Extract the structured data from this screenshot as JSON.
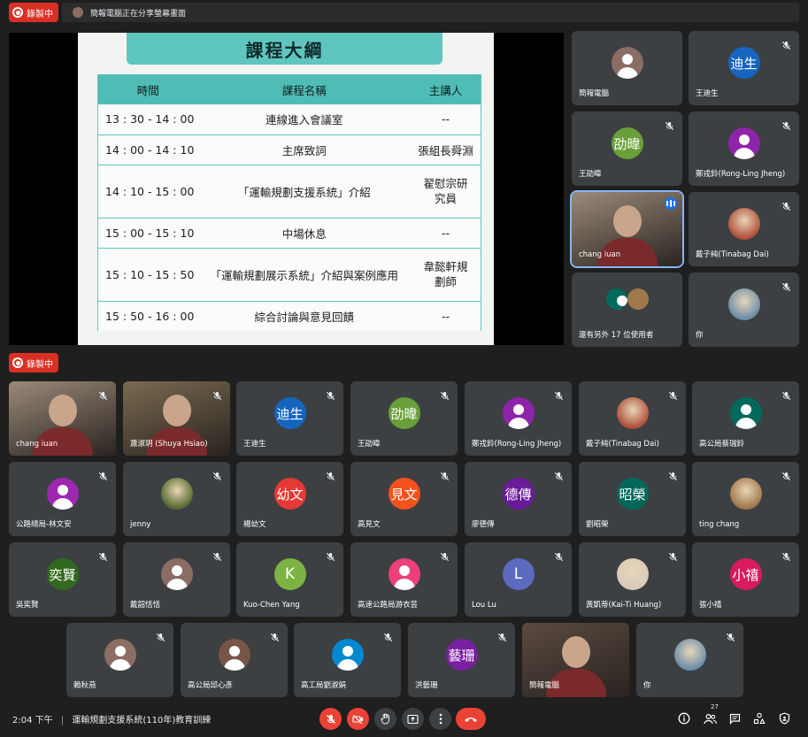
{
  "recording": {
    "label": "錄製中"
  },
  "share_banner": {
    "text": "簡報電腦正在分享螢幕畫面"
  },
  "slide": {
    "title": "課程大綱",
    "headers": [
      "時間",
      "課程名稱",
      "主講人"
    ],
    "rows": [
      {
        "time": "13 : 30 - 14 : 00",
        "course": "連線進入會議室",
        "speaker": "--"
      },
      {
        "time": "14 : 00 - 14 : 10",
        "course": "主席致詞",
        "speaker": "張組長舜淵"
      },
      {
        "time": "14 : 10 - 15 : 00",
        "course": "「運輸規劃支援系統」介紹",
        "speaker": "翟慰宗研究員"
      },
      {
        "time": "15 : 00 - 15 : 10",
        "course": "中場休息",
        "speaker": "--"
      },
      {
        "time": "15 : 10 - 15 : 50",
        "course": "「運輸規劃展示系統」介紹與案例應用",
        "speaker": "韋懿軒規劃師"
      },
      {
        "time": "15 : 50 - 16 : 00",
        "course": "綜合討論與意見回饋",
        "speaker": "--"
      }
    ]
  },
  "right_tiles": [
    {
      "name": "簡報電腦",
      "avatar_text": "",
      "color": "#8a6d63",
      "kind": "person",
      "muted": false
    },
    {
      "name": "王迪生",
      "avatar_text": "迪生",
      "color": "#1565c0",
      "kind": "initials",
      "muted": true
    },
    {
      "name": "王劭暐",
      "avatar_text": "劭暐",
      "color": "#689f38",
      "kind": "initials",
      "muted": true
    },
    {
      "name": "鄭戎鈴(Rong-Ling Jheng)",
      "avatar_text": "",
      "color": "#8e24aa",
      "kind": "person",
      "muted": true
    },
    {
      "name": "chang iuan",
      "avatar_text": "",
      "color": "#9a8a7a",
      "kind": "camera",
      "muted": false
    },
    {
      "name": "戴子純(Tinabag Dai)",
      "avatar_text": "",
      "color": "#b0503a",
      "kind": "image",
      "muted": true
    },
    {
      "name": "還有另外 17 位使用者",
      "avatar_text": "",
      "color": "#00695c",
      "kind": "group",
      "muted": false
    },
    {
      "name": "你",
      "avatar_text": "",
      "color": "#6d8ea8",
      "kind": "image",
      "muted": true
    }
  ],
  "grid_tiles": [
    {
      "name": "chang iuan",
      "avatar_text": "",
      "color": "#9a8a7a",
      "kind": "camera",
      "muted": true
    },
    {
      "name": "蕭淑玥 (Shuya Hsiao)",
      "avatar_text": "",
      "color": "#7a6a50",
      "kind": "camera",
      "muted": true
    },
    {
      "name": "王迪生",
      "avatar_text": "迪生",
      "color": "#1565c0",
      "kind": "initials",
      "muted": true
    },
    {
      "name": "王劭暐",
      "avatar_text": "劭暐",
      "color": "#689f38",
      "kind": "initials",
      "muted": true
    },
    {
      "name": "鄭戎鈴(Rong-Ling Jheng)",
      "avatar_text": "",
      "color": "#8e24aa",
      "kind": "person",
      "muted": true
    },
    {
      "name": "戴子純(Tinabag Dai)",
      "avatar_text": "",
      "color": "#b0503a",
      "kind": "image",
      "muted": true
    },
    {
      "name": "高公局蔡瑞鈴",
      "avatar_text": "",
      "color": "#00695c",
      "kind": "person",
      "muted": true
    },
    {
      "name": "公路總局-林文安",
      "avatar_text": "",
      "color": "#9c27b0",
      "kind": "person",
      "muted": true
    },
    {
      "name": "jenny",
      "avatar_text": "",
      "color": "#556b2f",
      "kind": "image",
      "muted": true
    },
    {
      "name": "楊幼文",
      "avatar_text": "幼文",
      "color": "#e53935",
      "kind": "initials",
      "muted": true
    },
    {
      "name": "高見文",
      "avatar_text": "見文",
      "color": "#f4511e",
      "kind": "initials",
      "muted": true
    },
    {
      "name": "廖德傳",
      "avatar_text": "德傳",
      "color": "#6a1b9a",
      "kind": "initials",
      "muted": true
    },
    {
      "name": "劉昭榮",
      "avatar_text": "昭榮",
      "color": "#00695c",
      "kind": "initials",
      "muted": true
    },
    {
      "name": "ting chang",
      "avatar_text": "",
      "color": "#a0784a",
      "kind": "image",
      "muted": true
    },
    {
      "name": "吳奕賢",
      "avatar_text": "奕賢",
      "color": "#33691e",
      "kind": "initials",
      "muted": true
    },
    {
      "name": "戴韶恬恬",
      "avatar_text": "",
      "color": "#8a6d63",
      "kind": "person",
      "muted": true
    },
    {
      "name": "Kuo-Chen Yang",
      "avatar_text": "K",
      "color": "#7cb342",
      "kind": "initials",
      "muted": true
    },
    {
      "name": "高速公路局游衣芸",
      "avatar_text": "",
      "color": "#ec407a",
      "kind": "person",
      "muted": true
    },
    {
      "name": "Lou Lu",
      "avatar_text": "L",
      "color": "#5c6bc0",
      "kind": "initials",
      "muted": true
    },
    {
      "name": "黃凱蒂(Kai-Ti Huang)",
      "avatar_text": "",
      "color": "#d8cbb8",
      "kind": "image",
      "muted": true
    },
    {
      "name": "張小禧",
      "avatar_text": "小禧",
      "color": "#d81b60",
      "kind": "initials",
      "muted": true
    },
    {
      "name": "賴秋燕",
      "avatar_text": "",
      "color": "#8d6e63",
      "kind": "person",
      "muted": true
    },
    {
      "name": "高公局邱心彥",
      "avatar_text": "",
      "color": "#795548",
      "kind": "person",
      "muted": true
    },
    {
      "name": "高工局劉淑娟",
      "avatar_text": "",
      "color": "#0288d1",
      "kind": "person",
      "muted": true
    },
    {
      "name": "洪藝珊",
      "avatar_text": "藝珊",
      "color": "#7b1fa2",
      "kind": "initials",
      "muted": true
    },
    {
      "name": "簡報電腦",
      "avatar_text": "",
      "color": "#5a4a40",
      "kind": "camera",
      "muted": false
    },
    {
      "name": "你",
      "avatar_text": "",
      "color": "#6d8ea8",
      "kind": "image",
      "muted": true
    }
  ],
  "bottom": {
    "time": "2:04 下午",
    "separator": "|",
    "meeting_title": "運輸規劃支援系統(110年)教育訓練",
    "participant_count": "27"
  }
}
